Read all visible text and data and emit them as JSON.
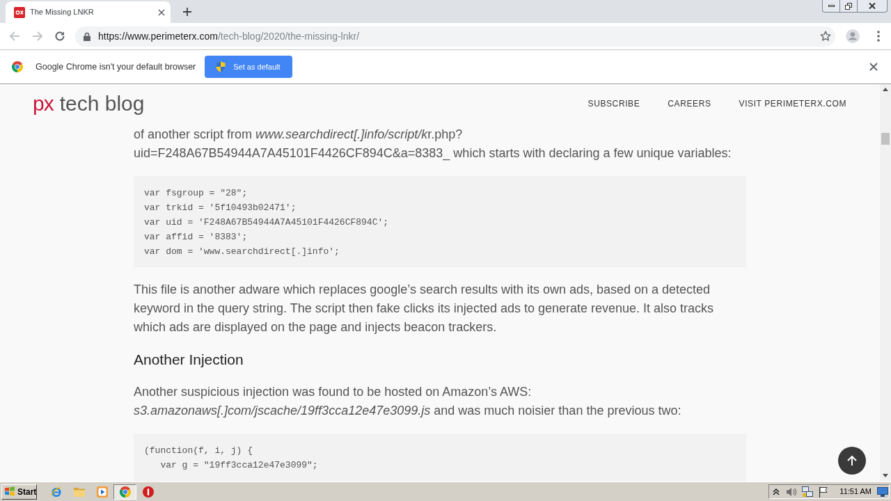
{
  "browser": {
    "tabs": [
      {
        "title": "The Missing LNKR",
        "selected": true
      }
    ],
    "back": {
      "disabled": true
    },
    "forward": {
      "disabled": true
    },
    "address_bar": {
      "host": "https://www.perimeterx.com",
      "path": "/tech-blog/2020/the-missing-lnkr/"
    }
  },
  "infobar": {
    "message": "Google Chrome isn't your default browser",
    "button": "Set as default"
  },
  "site_header": {
    "logo_mark": "px",
    "logo_text": "tech blog",
    "nav": [
      "SUBSCRIBE",
      "CAREERS",
      "VISIT PERIMETERX.COM"
    ]
  },
  "article": [
    {
      "kind": "paragraph",
      "lines": [
        [
          {
            "text": "of another script from ",
            "italic": false
          },
          {
            "text": "www.searchdirect[.]info/script/k",
            "italic": true
          },
          {
            "text": "r.php?",
            "italic": false
          }
        ],
        [
          {
            "text": "uid=F248A67B54944A7A45101F4426CF894C&a=8383_ which starts with declaring a few unique variables:",
            "italic": false
          }
        ]
      ]
    },
    {
      "kind": "code",
      "lines": [
        "var fsgroup = \"28\";",
        "var trkid = '5f10493b02471';",
        "var uid = 'F248A67B54944A7A45101F4426CF894C';",
        "var affid = '8383';",
        "var dom = 'www.searchdirect[.]info';"
      ]
    },
    {
      "kind": "paragraph",
      "lines": [
        [
          {
            "text": "This file is another adware which replaces google’s search results with its own ads, based on a detected",
            "italic": false
          }
        ],
        [
          {
            "text": "keyword in the query string. The script then fake clicks its injected ads to generate revenue. It also tracks",
            "italic": false
          }
        ],
        [
          {
            "text": "which ads are displayed on the page and injects beacon trackers.",
            "italic": false
          }
        ]
      ]
    },
    {
      "kind": "heading",
      "text": "Another Injection"
    },
    {
      "kind": "paragraph",
      "lines": [
        [
          {
            "text": "Another suspicious injection was found to be hosted on Amazon’s AWS:",
            "italic": false
          }
        ],
        [
          {
            "text": "s3.amazonaws[.]com/jscache/19ff3cca12e47e3099.js",
            "italic": true
          },
          {
            "text": " and was much noisier than the previous two:",
            "italic": false
          }
        ]
      ]
    },
    {
      "kind": "code",
      "lines": [
        "(function(f, i, j) {",
        "   var g = \"19ff3cca12e47e3099\";"
      ]
    }
  ],
  "taskbar": {
    "start": "Start",
    "apps": [
      {
        "kind": "ie",
        "selected": false
      },
      {
        "kind": "folder",
        "selected": false
      },
      {
        "kind": "player",
        "selected": false
      },
      {
        "kind": "chrome",
        "selected": true
      },
      {
        "kind": "alert",
        "selected": false
      }
    ],
    "clock": "11:51 AM"
  }
}
